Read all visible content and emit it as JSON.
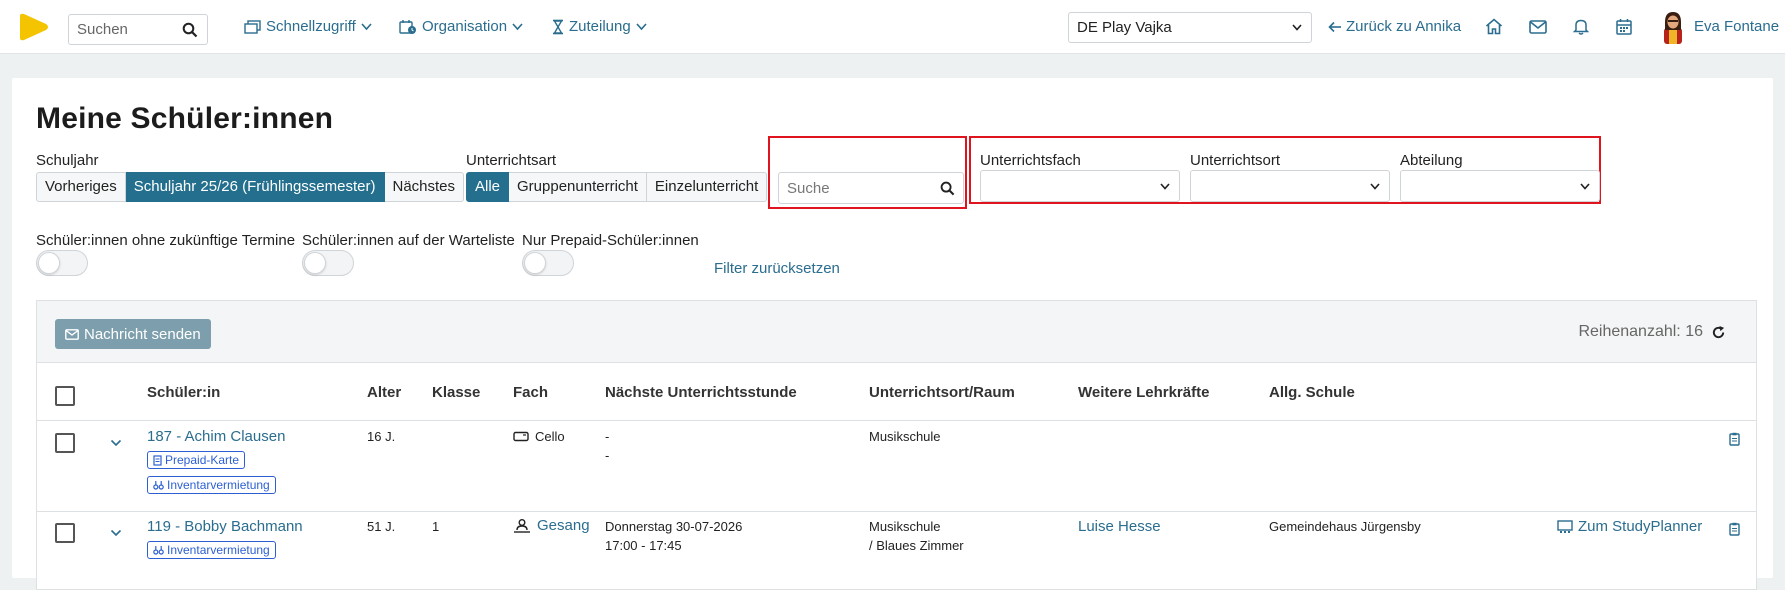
{
  "nav": {
    "search_placeholder": "Suchen",
    "items": [
      "Schnellzugriff",
      "Organisation",
      "Zuteilung"
    ],
    "school_select": "DE Play Vajka",
    "back_link": "Zurück zu Annika",
    "user_name": "Eva Fontane"
  },
  "page": {
    "title": "Meine Schüler:innen",
    "schuljahr_label": "Schuljahr",
    "schuljahr_buttons": [
      "Vorheriges",
      "Schuljahr 25/26 (Frühlingssemester)",
      "Nächstes"
    ],
    "unterrichtsart_label": "Unterrichtsart",
    "unterrichtsart_buttons": [
      "Alle",
      "Gruppenunterricht",
      "Einzelunterricht"
    ],
    "search_placeholder": "Suche",
    "unterrichtsfach_label": "Unterrichtsfach",
    "unterrichtsort_label": "Unterrichtsort",
    "abteilung_label": "Abteilung",
    "toggles": [
      "Schüler:innen ohne zukünftige Termine",
      "Schüler:innen auf der Warteliste",
      "Nur Prepaid-Schüler:innen"
    ],
    "reset_link": "Filter zurücksetzen"
  },
  "table": {
    "message_button": "Nachricht senden",
    "row_count": "Reihenanzahl: 16",
    "headers": [
      "Schüler:in",
      "Alter",
      "Klasse",
      "Fach",
      "Nächste Unterrichtsstunde",
      "Unterrichtsort/Raum",
      "Weitere Lehrkräfte",
      "Allg. Schule"
    ],
    "rows": [
      {
        "name": "187 - Achim Clausen",
        "tags": [
          "Prepaid-Karte",
          "Inventarvermietung"
        ],
        "alter": "16 J.",
        "klasse": "",
        "fach": "Cello",
        "next1": "-",
        "next2": "-",
        "ort1": "Musikschule",
        "ort2": "",
        "lehrkraft": "",
        "schule": "",
        "studyplanner": ""
      },
      {
        "name": "119 - Bobby Bachmann",
        "tags": [
          "Inventarvermietung"
        ],
        "alter": "51 J.",
        "klasse": "1",
        "fach": "Gesang",
        "next1": "Donnerstag 30-07-2026",
        "next2": "17:00 - 17:45",
        "ort1": "Musikschule",
        "ort2": "/ Blaues Zimmer",
        "lehrkraft": "Luise Hesse",
        "schule": "Gemeindehaus Jürgensby",
        "studyplanner": "Zum StudyPlanner"
      }
    ]
  },
  "colors": {
    "accent": "#236f8d",
    "link": "#2a6d8f",
    "highlight": "#e0141e",
    "tag": "#2d5fd3",
    "logo": "#f5c400"
  }
}
